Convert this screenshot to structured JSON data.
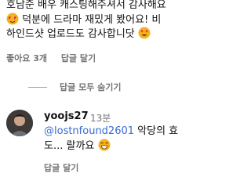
{
  "comment1": {
    "line1": "호남준 배우 캐스팅해주셔서 감사해요",
    "line2": "덕분에 드라마 재밌게 봤어요! 비",
    "line3": "하인드샷 업로드도 감사합니닷",
    "likes": "좋아요 3개",
    "reply": "답글 달기"
  },
  "toggle_replies": "답글 모두 숨기기",
  "reply1": {
    "username": "yoojs27",
    "time": "13분",
    "mention": "@lostnfound2601",
    "text_after_mention": " 악당의 효",
    "line2": "도... 랄까요",
    "reply": "답글 달기"
  },
  "icons": {
    "emoji1": "face-with-heart-eyes-icon",
    "emoji2": "smiling-face-with-heart-eyes-icon",
    "emoji3": "grinning-face-icon"
  }
}
